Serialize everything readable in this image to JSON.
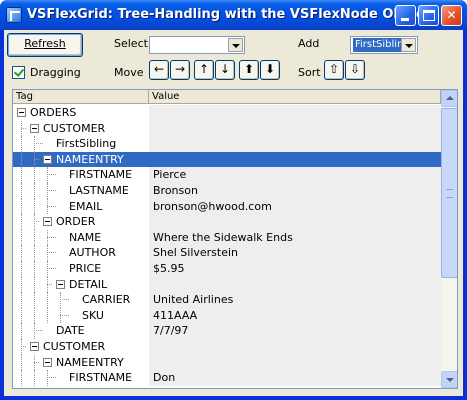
{
  "window": {
    "title": "VSFlexGrid: Tree-Handling with the VSFlexNode Object"
  },
  "toolbar": {
    "refresh_label": "Refresh",
    "select_label": "Select",
    "select_value": "",
    "add_label": "Add",
    "add_value": "FirstSibling",
    "dragging_label": "Dragging",
    "dragging_checked": true,
    "move_label": "Move",
    "move_buttons": [
      "←",
      "→",
      "↑",
      "↓",
      "⬆",
      "⬇"
    ],
    "sort_label": "Sort",
    "sort_buttons": [
      "⇧",
      "⇩"
    ]
  },
  "grid": {
    "columns": [
      "Tag",
      "Value"
    ],
    "rows": [
      {
        "tag": "ORDERS",
        "value": "",
        "level": 0,
        "expander": true
      },
      {
        "tag": "CUSTOMER",
        "value": "",
        "level": 1,
        "expander": true
      },
      {
        "tag": "FirstSibling",
        "value": "",
        "level": 2,
        "expander": false
      },
      {
        "tag": "NAMEENTRY",
        "value": "",
        "level": 2,
        "expander": true,
        "selected": true
      },
      {
        "tag": "FIRSTNAME",
        "value": "Pierce",
        "level": 3,
        "expander": false
      },
      {
        "tag": "LASTNAME",
        "value": "Bronson",
        "level": 3,
        "expander": false
      },
      {
        "tag": "EMAIL",
        "value": "bronson@hwood.com",
        "level": 3,
        "expander": false
      },
      {
        "tag": "ORDER",
        "value": "",
        "level": 2,
        "expander": true
      },
      {
        "tag": "NAME",
        "value": "Where the Sidewalk Ends",
        "level": 3,
        "expander": false
      },
      {
        "tag": "AUTHOR",
        "value": "Shel Silverstein",
        "level": 3,
        "expander": false
      },
      {
        "tag": "PRICE",
        "value": "$5.95",
        "level": 3,
        "expander": false
      },
      {
        "tag": "DETAIL",
        "value": "",
        "level": 3,
        "expander": true
      },
      {
        "tag": "CARRIER",
        "value": "United Airlines",
        "level": 4,
        "expander": false
      },
      {
        "tag": "SKU",
        "value": "411AAA",
        "level": 4,
        "expander": false
      },
      {
        "tag": "DATE",
        "value": "7/7/97",
        "level": 2,
        "expander": false
      },
      {
        "tag": "CUSTOMER",
        "value": "",
        "level": 1,
        "expander": true
      },
      {
        "tag": "NAMEENTRY",
        "value": "",
        "level": 2,
        "expander": true
      },
      {
        "tag": "FIRSTNAME",
        "value": "Don",
        "level": 3,
        "expander": false
      }
    ]
  },
  "colors": {
    "selection": "#316ac5",
    "title_bar": "#0453e6",
    "window_face": "#ece9d8"
  }
}
